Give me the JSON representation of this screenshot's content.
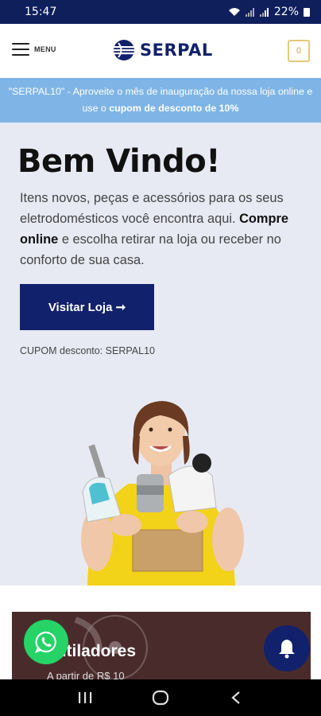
{
  "status_bar": {
    "time": "15:47",
    "battery": "22%"
  },
  "header": {
    "menu_label": "MENU",
    "logo_text": "SERPAL",
    "cart_count": "0"
  },
  "promo": {
    "text_start": "\"SERPAL10\" - Aproveite o mês de inauguração da nossa loja online e use o ",
    "text_bold": "cupom de desconto de 10%"
  },
  "hero": {
    "title": "Bem Vindo!",
    "desc_line1": "Itens novos, peças e acessórios para os seus eletrodomésticos você encontra aqui.",
    "desc_bold": "Compre online",
    "desc_line2": " e escolha retirar na loja ou receber no conforto de sua casa.",
    "button_label": "Visitar Loja ➞",
    "coupon_text": "CUPOM desconto: SERPAL10"
  },
  "category": {
    "title": "entiladores",
    "subtitle": "A partir de R$ 10"
  },
  "colors": {
    "brand_navy": "#12216b",
    "promo_blue": "#7fb5e6",
    "hero_bg": "#e7eaf3",
    "whatsapp_green": "#25d366"
  },
  "icons": {
    "menu": "hamburger-icon",
    "cart": "cart-icon",
    "whatsapp": "whatsapp-icon",
    "bell": "bell-icon"
  }
}
